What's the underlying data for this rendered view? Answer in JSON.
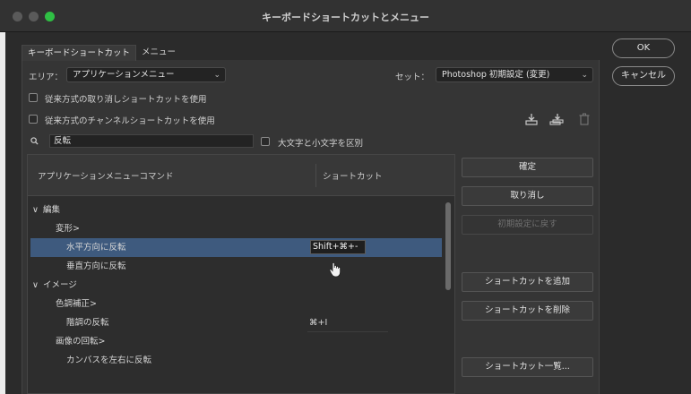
{
  "window": {
    "title": "キーボードショートカットとメニュー"
  },
  "tabs": [
    {
      "label": "キーボードショートカット",
      "active": true
    },
    {
      "label": "メニュー",
      "active": false
    }
  ],
  "area": {
    "label": "エリア：",
    "value": "アプリケーションメニュー"
  },
  "set": {
    "label": "セット：",
    "value": "Photoshop 初期設定 (変更)"
  },
  "options": {
    "legacy_undo": "従来方式の取り消しショートカットを使用",
    "legacy_channel": "従来方式のチャンネルショートカットを使用",
    "match_case": "大文字と小文字を区別"
  },
  "search": {
    "value": "反転"
  },
  "table": {
    "col_command": "アプリケーションメニューコマンド",
    "col_shortcut": "ショートカット",
    "rows": [
      {
        "label": "編集",
        "indent": 0,
        "expander": "∨",
        "shortcut": ""
      },
      {
        "label": "変形>",
        "indent": 1,
        "expander": "",
        "shortcut": ""
      },
      {
        "label": "水平方向に反転",
        "indent": 2,
        "expander": "",
        "shortcut": "Shift+⌘+-",
        "selected": true
      },
      {
        "label": "垂直方向に反転",
        "indent": 2,
        "expander": "",
        "shortcut": ""
      },
      {
        "label": "イメージ",
        "indent": 0,
        "expander": "∨",
        "shortcut": ""
      },
      {
        "label": "色調補正>",
        "indent": 1,
        "expander": "",
        "shortcut": ""
      },
      {
        "label": "階調の反転",
        "indent": 2,
        "expander": "",
        "shortcut": "⌘+I"
      },
      {
        "label": "画像の回転>",
        "indent": 1,
        "expander": "",
        "shortcut": ""
      },
      {
        "label": "カンバスを左右に反転",
        "indent": 2,
        "expander": "",
        "shortcut": ""
      }
    ]
  },
  "buttons": {
    "accept": "確定",
    "undo": "取り消し",
    "use_default": "初期設定に戻す",
    "add_shortcut": "ショートカットを追加",
    "delete_shortcut": "ショートカットを削除",
    "summarize": "ショートカット一覧..."
  },
  "dialog": {
    "ok": "OK",
    "cancel": "キャンセル"
  },
  "icons": {
    "save": "save-set-icon",
    "save_as": "save-set-as-icon",
    "delete": "trash-icon"
  },
  "colors": {
    "selection": "#3e5a7e",
    "zoom": "#2fbf44"
  }
}
